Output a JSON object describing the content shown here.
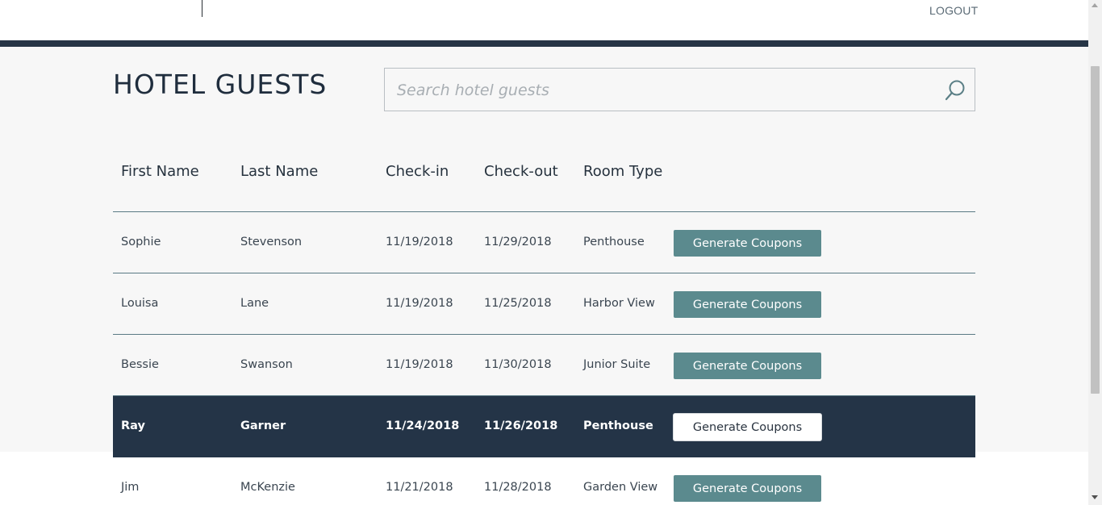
{
  "header": {
    "logout_label": "LOGOUT"
  },
  "page": {
    "title": "HOTEL GUESTS"
  },
  "search": {
    "placeholder": "Search hotel guests",
    "value": ""
  },
  "table": {
    "columns": [
      "First Name",
      "Last Name",
      "Check-in",
      "Check-out",
      "Room Type"
    ],
    "button_label": "Generate Coupons",
    "rows": [
      {
        "first": "Sophie",
        "last": "Stevenson",
        "checkin": "11/19/2018",
        "checkout": "11/29/2018",
        "room": "Penthouse",
        "selected": false
      },
      {
        "first": "Louisa",
        "last": "Lane",
        "checkin": "11/19/2018",
        "checkout": "11/25/2018",
        "room": "Harbor View",
        "selected": false
      },
      {
        "first": "Bessie",
        "last": "Swanson",
        "checkin": "11/19/2018",
        "checkout": "11/30/2018",
        "room": "Junior Suite",
        "selected": false
      },
      {
        "first": "Ray",
        "last": "Garner",
        "checkin": "11/24/2018",
        "checkout": "11/26/2018",
        "room": "Penthouse",
        "selected": true
      },
      {
        "first": "Jim",
        "last": "McKenzie",
        "checkin": "11/21/2018",
        "checkout": "11/28/2018",
        "room": "Garden View",
        "selected": false
      }
    ]
  },
  "colors": {
    "navy": "#243447",
    "teal_button": "#5b8a8e",
    "background": "#f7f7f7"
  },
  "icons": {
    "search": "search-icon"
  }
}
